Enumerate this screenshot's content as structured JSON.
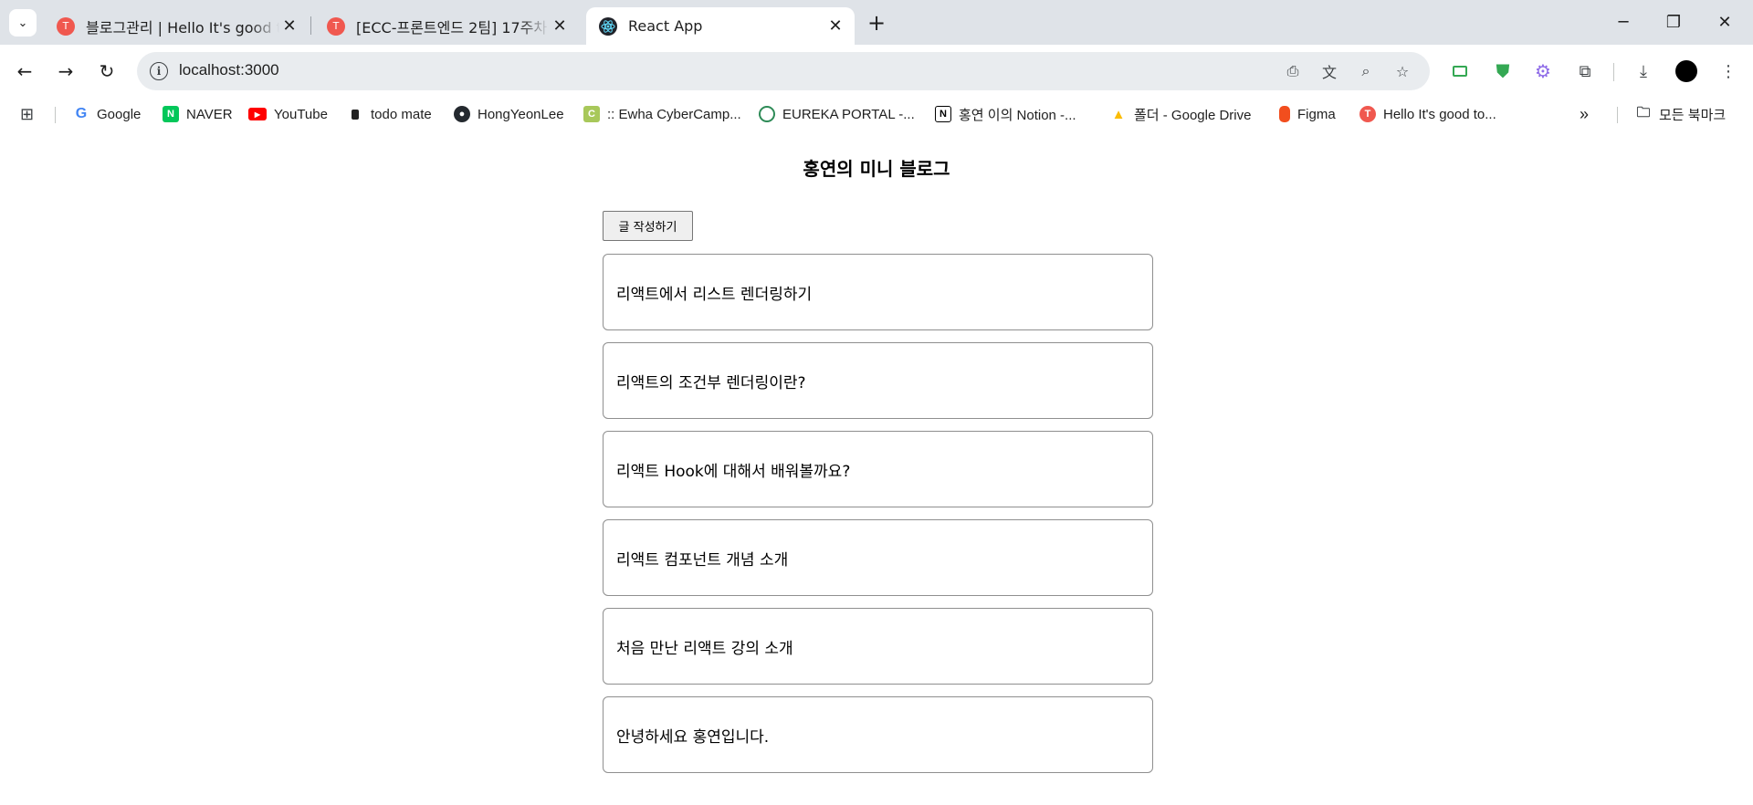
{
  "tabs": [
    {
      "title": "블로그관리 | Hello It's good to",
      "favicon": "tistory-icon"
    },
    {
      "title": "[ECC-프론트엔드 2팀] 17주차 스",
      "favicon": "tistory-icon"
    },
    {
      "title": "React App",
      "favicon": "react-icon",
      "active": true
    }
  ],
  "address": {
    "url": "localhost:3000"
  },
  "bookmarks": [
    {
      "label": "Google"
    },
    {
      "label": "NAVER"
    },
    {
      "label": "YouTube"
    },
    {
      "label": "todo mate"
    },
    {
      "label": "HongYeonLee"
    },
    {
      "label": ":: Ewha CyberCamp..."
    },
    {
      "label": "EUREKA PORTAL -..."
    },
    {
      "label": "홍연 이의 Notion -..."
    },
    {
      "label": "폴더 - Google Drive"
    },
    {
      "label": "Figma"
    },
    {
      "label": "Hello It's good to..."
    }
  ],
  "bookmarks_overflow": "»",
  "all_bookmarks": "모든 북마크",
  "page": {
    "title": "홍연의 미니 블로그",
    "write_button": "글 작성하기",
    "posts": [
      "리액트에서 리스트 렌더링하기",
      "리액트의 조건부 렌더링이란?",
      "리액트 Hook에 대해서 배워볼까요?",
      "리액트 컴포넌트 개념 소개",
      "처음 만난 리액트 강의 소개",
      "안녕하세요 홍연입니다."
    ]
  },
  "colors": {
    "tabstrip": "#dfe3e8",
    "omnibox": "#e9ecef",
    "accent_green": "#34a853"
  }
}
